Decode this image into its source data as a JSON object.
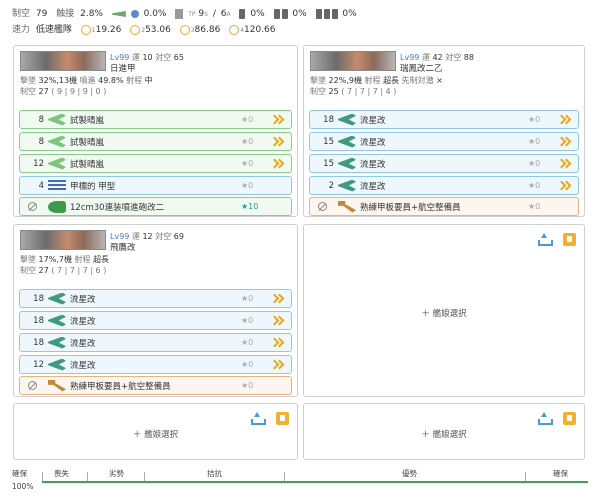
{
  "fleet": {
    "line1": {
      "seiku_label": "制空",
      "seiku_value": "79",
      "contact_label": "触接",
      "contact_value": "2.8%",
      "a_value": "0.0%",
      "tp_value": "TP",
      "tp_s": "9",
      "tp_s_sub": "S",
      "tp_a": "6",
      "tp_a_sub": "A",
      "fuel_pct": "0%",
      "ammo_pct": "0%",
      "drum_pct": "0%"
    },
    "line2": {
      "speed_label": "速力",
      "speed_value": "低速艦隊",
      "los": [
        {
          "idx": "1",
          "value": "19.26"
        },
        {
          "idx": "2",
          "value": "53.06"
        },
        {
          "idx": "3",
          "value": "86.86"
        },
        {
          "idx": "4",
          "value": "120.66"
        }
      ]
    }
  },
  "ships": [
    {
      "lv": "Lv99",
      "luck_label": "運",
      "luck": "10",
      "aa_label": "対空",
      "aa": "65",
      "name": "日進甲",
      "line1": {
        "k1": "撃墜",
        "v1": "32%,13機",
        "k2": "噴進",
        "v2": "49.8%",
        "k3": "射程",
        "v3": "中"
      },
      "line2": {
        "k": "制空",
        "v": "27",
        "detail": "( 9 | 9 | 9 | 0 )"
      },
      "equips": [
        {
          "slot": "8",
          "name": "試製晴嵐",
          "star": "★0"
        },
        {
          "slot": "8",
          "name": "試製晴嵐",
          "star": "★0"
        },
        {
          "slot": "12",
          "name": "試製晴嵐",
          "star": "★0"
        },
        {
          "slot": "4",
          "name": "甲標的 甲型",
          "star": "★0"
        },
        {
          "slot": "",
          "name": "12cm30連装噴進砲改二",
          "star": "★10"
        }
      ]
    },
    {
      "lv": "Lv99",
      "luck_label": "運",
      "luck": "42",
      "aa_label": "対空",
      "aa": "88",
      "name": "瑞鳳改二乙",
      "line1": {
        "k1": "撃墜",
        "v1": "22%,9機",
        "k2": "射程",
        "v2": "超長",
        "k3": "先制対潜",
        "v3": "×"
      },
      "line2": {
        "k": "制空",
        "v": "25",
        "detail": "( 7 | 7 | 7 | 4 )"
      },
      "equips": [
        {
          "slot": "18",
          "name": "流星改",
          "star": "★0"
        },
        {
          "slot": "15",
          "name": "流星改",
          "star": "★0"
        },
        {
          "slot": "15",
          "name": "流星改",
          "star": "★0"
        },
        {
          "slot": "2",
          "name": "流星改",
          "star": "★0"
        },
        {
          "slot": "",
          "name": "熟練甲板要員+航空整備員",
          "star": "★0"
        }
      ]
    },
    {
      "lv": "Lv99",
      "luck_label": "運",
      "luck": "12",
      "aa_label": "対空",
      "aa": "69",
      "name": "飛鷹改",
      "line1": {
        "k1": "撃墜",
        "v1": "17%,7機",
        "k2": "射程",
        "v2": "超長"
      },
      "line2": {
        "k": "制空",
        "v": "27",
        "detail": "( 7 | 7 | 7 | 6 )"
      },
      "equips": [
        {
          "slot": "18",
          "name": "流星改",
          "star": "★0"
        },
        {
          "slot": "18",
          "name": "流星改",
          "star": "★0"
        },
        {
          "slot": "18",
          "name": "流星改",
          "star": "★0"
        },
        {
          "slot": "12",
          "name": "流星改",
          "star": "★0"
        },
        {
          "slot": "",
          "name": "熟練甲板要員+航空整備員",
          "star": "★0"
        }
      ]
    }
  ],
  "empty_slot_label": "＋ 艦娘選択",
  "air_status": {
    "left_label": "確保",
    "segments": [
      "喪失",
      "劣勢",
      "拮抗",
      "優勢",
      "確保"
    ],
    "percent": "100%"
  },
  "colors": {
    "accent": "#4a7bd0",
    "chevron": "#e8a918",
    "air_line": "#3aa64a"
  }
}
